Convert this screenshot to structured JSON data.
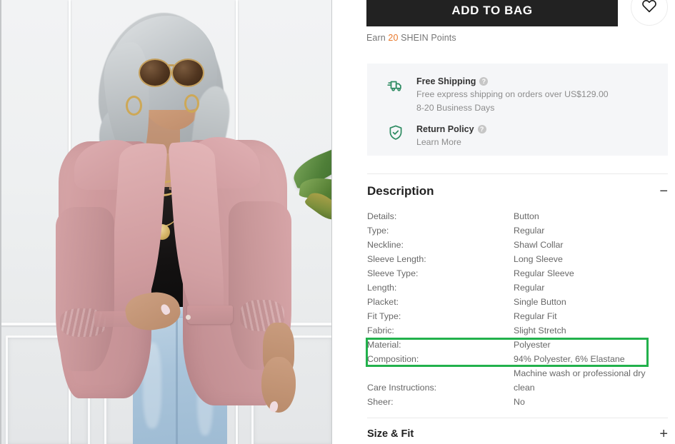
{
  "product_image": {
    "alt": "Model wearing pink open-front blazer with black lace camisole and light blue jeans",
    "icon": "product-photo"
  },
  "actions": {
    "add_to_bag_label": "ADD TO BAG",
    "wishlist_icon": "heart-icon",
    "earn_prefix": "Earn ",
    "earn_points": "20",
    "earn_suffix": " SHEIN Points"
  },
  "shipping": {
    "free_shipping": {
      "icon": "truck-icon",
      "title": "Free Shipping",
      "help_icon": "question-mark-icon",
      "help_glyph": "?",
      "line1": "Free express shipping on orders over US$129.00",
      "line2": "8-20 Business Days"
    },
    "return_policy": {
      "icon": "shield-check-icon",
      "title": "Return Policy",
      "help_icon": "question-mark-icon",
      "help_glyph": "?",
      "link": "Learn More"
    }
  },
  "description": {
    "title": "Description",
    "toggle": "−",
    "rows": [
      {
        "key": "Details:",
        "value": "Button"
      },
      {
        "key": "Type:",
        "value": "Regular"
      },
      {
        "key": "Neckline:",
        "value": "Shawl Collar"
      },
      {
        "key": "Sleeve Length:",
        "value": "Long Sleeve"
      },
      {
        "key": "Sleeve Type:",
        "value": "Regular Sleeve"
      },
      {
        "key": "Length:",
        "value": "Regular"
      },
      {
        "key": "Placket:",
        "value": "Single Button"
      },
      {
        "key": "Fit Type:",
        "value": "Regular Fit"
      },
      {
        "key": "Fabric:",
        "value": "Slight Stretch"
      },
      {
        "key": "Material:",
        "value": "Polyester"
      },
      {
        "key": "Composition:",
        "value": "94% Polyester, 6% Elastane"
      },
      {
        "key": "Care Instructions:",
        "value": "Machine wash or professional dry clean"
      },
      {
        "key": "Sheer:",
        "value": "No"
      }
    ]
  },
  "size_fit": {
    "title": "Size & Fit",
    "toggle": "+"
  },
  "annotation": {
    "name": "highlight-box",
    "color": "#22b14c",
    "covers": "Material and Composition rows"
  },
  "colors": {
    "button_bg": "#222222",
    "points_orange": "#e8782a",
    "shipping_green": "#2e8b62",
    "info_box_bg": "#f5f6f8",
    "highlight_green": "#22b14c"
  }
}
